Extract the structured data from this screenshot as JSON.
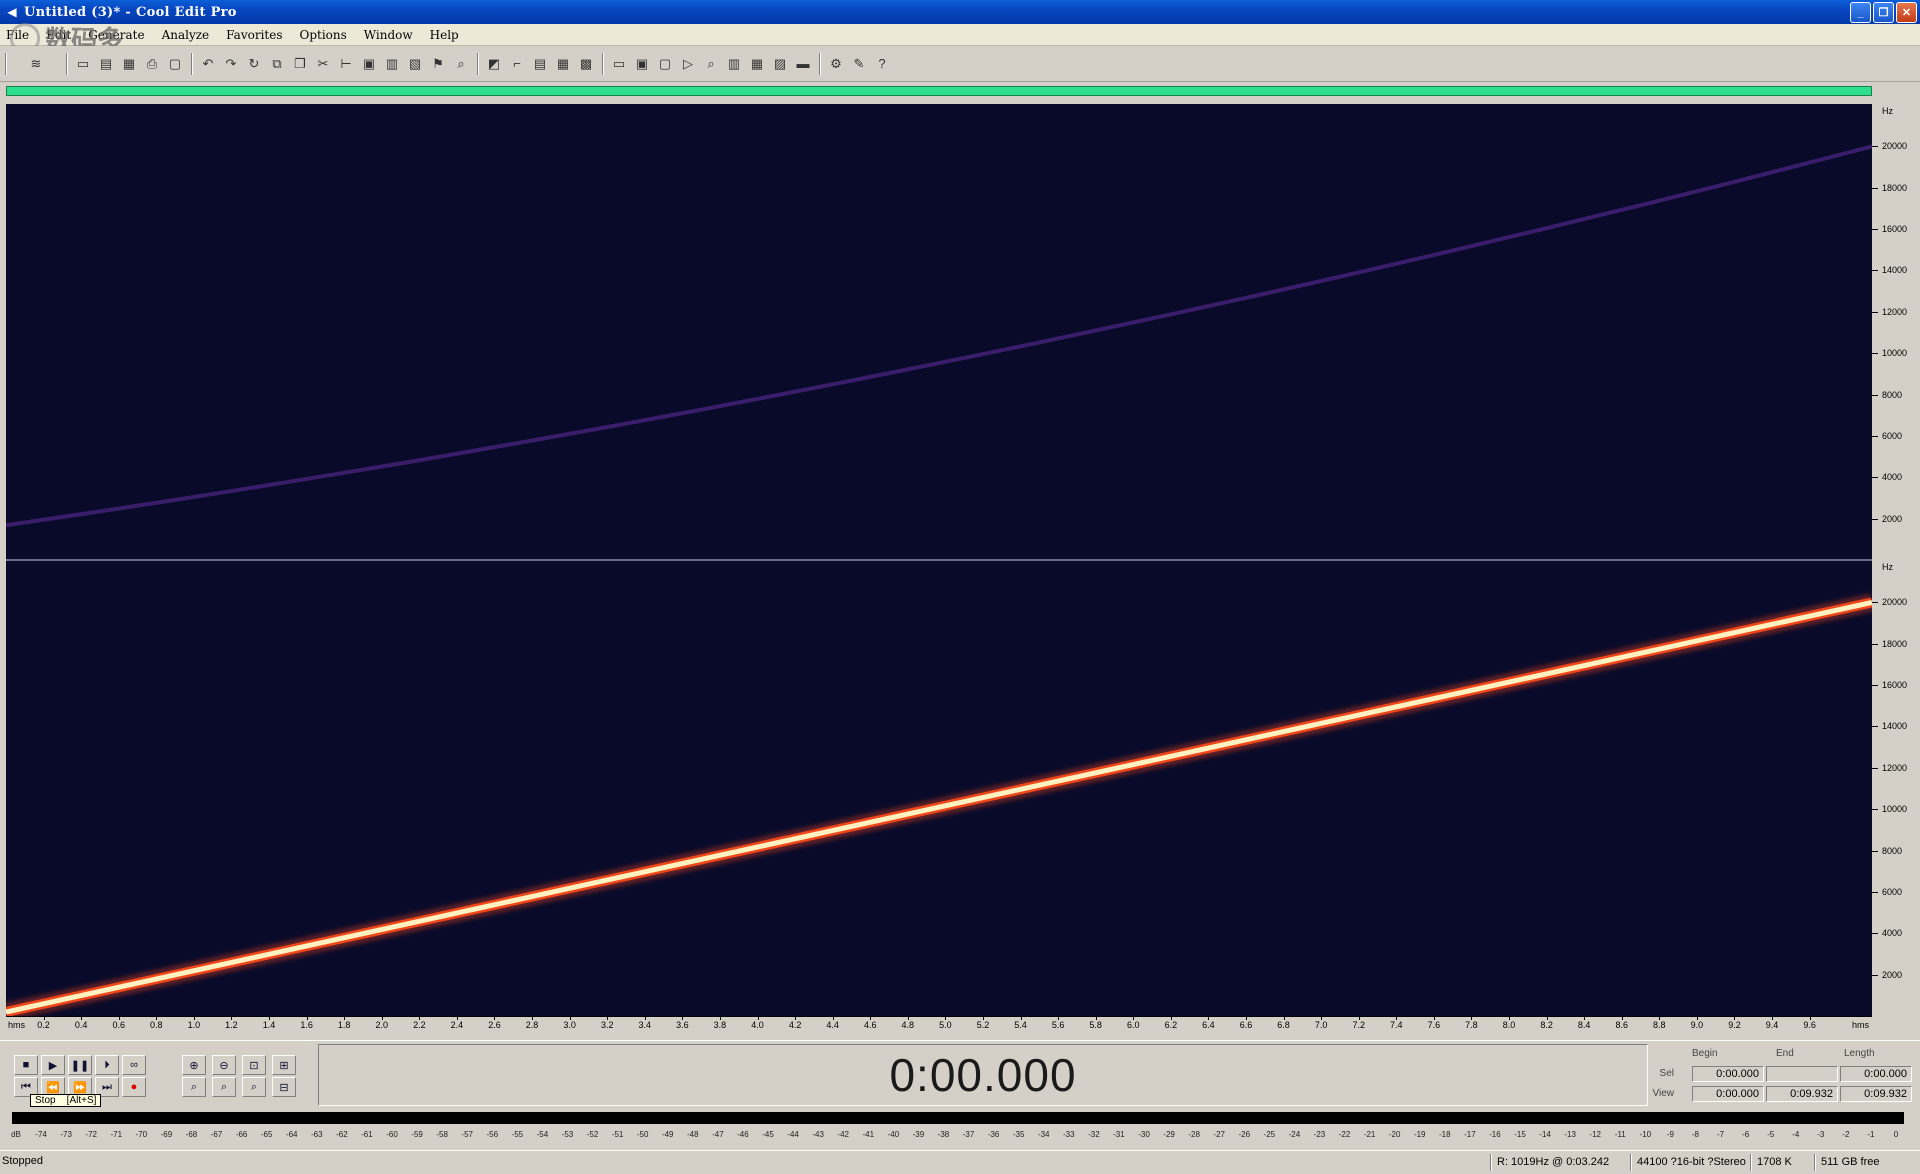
{
  "window": {
    "title": "Untitled (3)* - Cool Edit Pro",
    "controls": [
      "minimize",
      "maximize",
      "close"
    ]
  },
  "watermark": {
    "text": "数码多",
    "site": "Soomal.com"
  },
  "menu": [
    "File",
    "Edit",
    "Generate",
    "Analyze",
    "Favorites",
    "Options",
    "Window",
    "Help"
  ],
  "toolbar": {
    "groups": [
      [
        "wave-view-icon"
      ],
      [
        "new-icon",
        "open-icon",
        "save-icon",
        "print-icon",
        "properties-icon"
      ],
      [
        "undo-icon",
        "redo-icon",
        "repeat-icon",
        "copy-new-icon",
        "copy-icon",
        "cut-icon",
        "trim-icon",
        "paste-icon",
        "paste-new-icon",
        "mix-paste-icon",
        "insert-cue-icon",
        "find-icon"
      ],
      [
        "waveform-view-icon",
        "spectral-view-icon",
        "spectral-pitch-icon",
        "pan-view-icon",
        "phase-view-icon"
      ],
      [
        "settings-icon",
        "frequency-analysis-icon",
        "stats-icon",
        "scripts-icon",
        "zoom-icon",
        "cd-icon",
        "metronome-icon",
        "info-icon",
        "meter-icon"
      ],
      [
        "tools-icon",
        "plugins-icon",
        "help-icon"
      ]
    ]
  },
  "spectral": {
    "channels": 2,
    "hz_axis_unit": "Hz",
    "hz_ticks": [
      "20000",
      "18000",
      "16000",
      "14000",
      "12000",
      "10000",
      "8000",
      "6000",
      "4000",
      "2000"
    ],
    "sweep_start_hz": 0,
    "sweep_end_hz": 20000,
    "colors": {
      "background": "#090a2a",
      "sweep_core": "#fff2c0",
      "sweep_edge": "#ff4a1a",
      "faint_sweep": "#3a1d6a"
    }
  },
  "time_axis": {
    "unit": "hms",
    "ticks": [
      "0.2",
      "0.4",
      "0.6",
      "0.8",
      "1.0",
      "1.2",
      "1.4",
      "1.6",
      "1.8",
      "2.0",
      "2.2",
      "2.4",
      "2.6",
      "2.8",
      "3.0",
      "3.2",
      "3.4",
      "3.6",
      "3.8",
      "4.0",
      "4.2",
      "4.4",
      "4.6",
      "4.8",
      "5.0",
      "5.2",
      "5.4",
      "5.6",
      "5.8",
      "6.0",
      "6.2",
      "6.4",
      "6.6",
      "6.8",
      "7.0",
      "7.2",
      "7.4",
      "7.6",
      "7.8",
      "8.0",
      "8.2",
      "8.4",
      "8.6",
      "8.8",
      "9.0",
      "9.2",
      "9.4",
      "9.6"
    ],
    "max_seconds": 9.932
  },
  "transport": {
    "row1": [
      "stop-icon",
      "play-icon",
      "pause-icon",
      "play-to-end-icon",
      "loop-icon"
    ],
    "row2": [
      "go-to-begin-icon",
      "rewind-icon",
      "fast-forward-icon",
      "go-to-end-icon",
      "record-icon"
    ],
    "zoom_row1": [
      "zoom-in-horizontal-icon",
      "zoom-out-horizontal-icon",
      "zoom-full-icon",
      "zoom-in-vertical-icon"
    ],
    "zoom_row2": [
      "zoom-left-icon",
      "zoom-right-icon",
      "zoom-selection-icon",
      "zoom-out-vertical-icon"
    ],
    "tooltip": "Stop    [Alt+S]"
  },
  "time_display": "0:00.000",
  "selection": {
    "headers": {
      "begin": "Begin",
      "end": "End",
      "length": "Length"
    },
    "sel": {
      "label": "Sel",
      "begin": "0:00.000",
      "end": "",
      "length": "0:00.000"
    },
    "view": {
      "label": "View",
      "begin": "0:00.000",
      "end": "0:09.932",
      "length": "0:09.932"
    }
  },
  "meter": {
    "db_labels": [
      "dB",
      "-74",
      "-73",
      "-72",
      "-71",
      "-70",
      "-69",
      "-68",
      "-67",
      "-66",
      "-65",
      "-64",
      "-63",
      "-62",
      "-61",
      "-60",
      "-59",
      "-58",
      "-57",
      "-56",
      "-55",
      "-54",
      "-53",
      "-52",
      "-51",
      "-50",
      "-49",
      "-48",
      "-47",
      "-46",
      "-45",
      "-44",
      "-43",
      "-42",
      "-41",
      "-40",
      "-39",
      "-38",
      "-37",
      "-36",
      "-35",
      "-34",
      "-33",
      "-32",
      "-31",
      "-30",
      "-29",
      "-28",
      "-27",
      "-26",
      "-25",
      "-24",
      "-23",
      "-22",
      "-21",
      "-20",
      "-19",
      "-18",
      "-17",
      "-16",
      "-15",
      "-14",
      "-13",
      "-12",
      "-11",
      "-10",
      "-9",
      "-8",
      "-7",
      "-6",
      "-5",
      "-4",
      "-3",
      "-2",
      "-1",
      "0"
    ]
  },
  "status": {
    "state": "Stopped",
    "cursor": "R: 1019Hz @  0:03.242",
    "format": "44100 ?16-bit ?Stereo",
    "size": "1708 K",
    "free": "511 GB free"
  }
}
